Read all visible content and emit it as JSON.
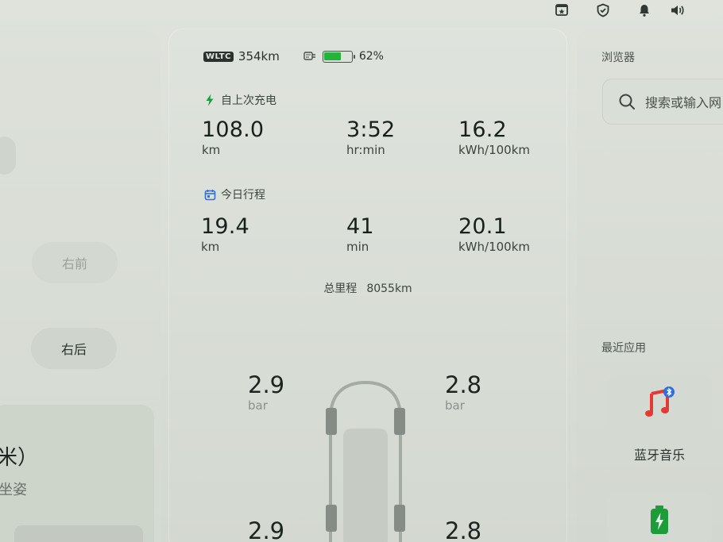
{
  "status_bar": {
    "icons": [
      "screen-badge-icon",
      "shield-check-icon",
      "bell-icon",
      "volume-icon"
    ]
  },
  "left_panel": {
    "front_right_label": "右前",
    "rear_right_label": "右后",
    "seat_card": {
      "title": "米）",
      "subtitle": "坐姿"
    }
  },
  "trip": {
    "wltc_badge": "WLTC",
    "range": "354km",
    "battery_percent_text": "62%",
    "battery_level": 0.62,
    "battery_color": "#25b33c",
    "since_charge": {
      "title": "自上次充电",
      "distance": {
        "value": "108.0",
        "unit": "km"
      },
      "duration": {
        "value": "3:52",
        "unit": "hr:min"
      },
      "consumption": {
        "value": "16.2",
        "unit": "kWh/100km"
      }
    },
    "today": {
      "title": "今日行程",
      "distance": {
        "value": "19.4",
        "unit": "km"
      },
      "duration": {
        "value": "41",
        "unit": "min"
      },
      "consumption": {
        "value": "20.1",
        "unit": "kWh/100km"
      }
    },
    "odometer_label": "总里程",
    "odometer_value": "8055km"
  },
  "tires": {
    "front_left": {
      "value": "2.9",
      "unit": "bar"
    },
    "front_right": {
      "value": "2.8",
      "unit": "bar"
    },
    "rear_left": {
      "value": "2.9"
    },
    "rear_right": {
      "value": "2.8"
    }
  },
  "right_panel": {
    "browser_title": "浏览器",
    "search_placeholder": "搜索或输入网",
    "recent_apps_title": "最近应用",
    "apps": [
      {
        "label": "蓝牙音乐",
        "icon": "bluetooth-music-icon"
      },
      {
        "label": "",
        "icon": "battery-charging-icon"
      }
    ]
  }
}
